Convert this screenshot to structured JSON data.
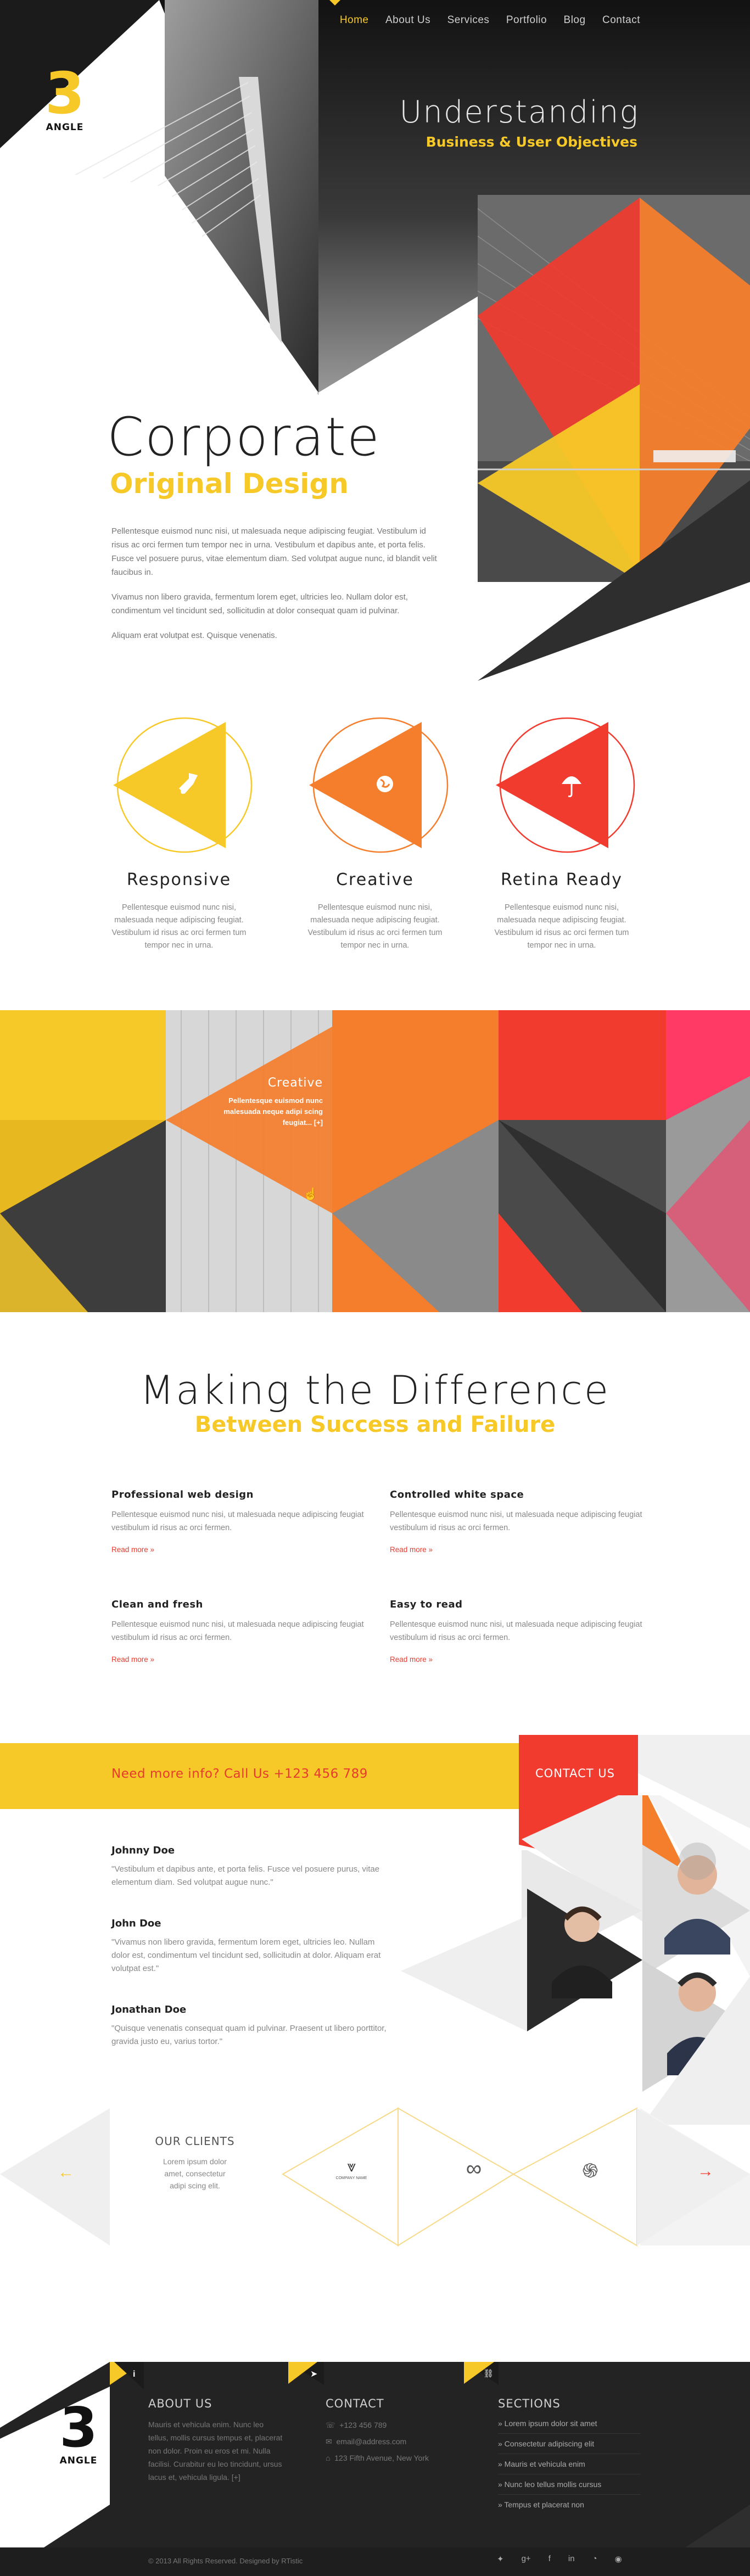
{
  "brand": {
    "logo_number": "3",
    "logo_word": "ANGLE",
    "accent_yellow": "#f7c928",
    "accent_orange": "#f57e2c",
    "accent_red": "#f23b2f",
    "accent_pink": "#ff3a64"
  },
  "nav": {
    "items": [
      {
        "label": "Home",
        "active": true
      },
      {
        "label": "About Us",
        "active": false
      },
      {
        "label": "Services",
        "active": false
      },
      {
        "label": "Portfolio",
        "active": false
      },
      {
        "label": "Blog",
        "active": false
      },
      {
        "label": "Contact",
        "active": false
      }
    ]
  },
  "hero": {
    "top_title": "Understanding",
    "top_subtitle": "Business & User Objectives",
    "title": "Corporate",
    "subtitle": "Original Design",
    "paragraphs": [
      "Pellentesque euismod nunc nisi, ut malesuada neque adipiscing feugiat. Vestibulum id risus ac orci fermen tum tempor nec in urna. Vestibulum et dapibus ante, et porta felis. Fusce vel posuere purus, vitae elementum diam. Sed volutpat augue nunc, id blandit velit faucibus in.",
      "Vivamus non libero gravida, fermentum lorem eget, ultricies leo. Nullam dolor est, condimentum vel tincidunt sed, sollicitudin at dolor consequat quam id pulvinar.",
      "Aliquam erat volutpat est. Quisque venenatis."
    ]
  },
  "features": [
    {
      "icon": "rocket-icon",
      "title": "Responsive",
      "text": "Pellentesque euismod nunc nisi, malesuada neque adipiscing feugiat. Vestibulum id risus ac orci fermen tum tempor nec in urna.",
      "color": "#f7c928"
    },
    {
      "icon": "globe-icon",
      "title": "Creative",
      "text": "Pellentesque euismod nunc nisi, malesuada neque adipiscing feugiat. Vestibulum id risus ac orci fermen tum tempor nec in urna.",
      "color": "#f57e2c"
    },
    {
      "icon": "umbrella-icon",
      "title": "Retina Ready",
      "text": "Pellentesque euismod nunc nisi, malesuada neque adipiscing feugiat. Vestibulum id risus ac orci fermen tum tempor nec in urna.",
      "color": "#f23b2f"
    }
  ],
  "portfolio": {
    "hover_title": "Creative",
    "hover_text": "Pellentesque euismod nunc malesuada neque adipi scing feugiat... [+]"
  },
  "difference": {
    "title": "Making the Difference",
    "subtitle": "Between Success and Failure",
    "items": [
      {
        "title": "Professional web design",
        "text": "Pellentesque euismod nunc nisi, ut malesuada neque adipiscing feugiat vestibulum id risus ac orci fermen.",
        "link": "Read more »"
      },
      {
        "title": "Controlled white space",
        "text": "Pellentesque euismod nunc nisi, ut malesuada neque adipiscing feugiat vestibulum id risus ac orci fermen.",
        "link": "Read more »"
      },
      {
        "title": "Clean and fresh",
        "text": "Pellentesque euismod nunc nisi, ut malesuada neque adipiscing feugiat vestibulum id risus ac orci fermen.",
        "link": "Read more »"
      },
      {
        "title": "Easy to read",
        "text": "Pellentesque euismod nunc nisi, ut malesuada neque adipiscing feugiat vestibulum id risus ac orci fermen.",
        "link": "Read more »"
      }
    ]
  },
  "cta": {
    "text": "Need more info? Call Us +123 456 789",
    "button": "CONTACT US"
  },
  "testimonials": [
    {
      "name": "Johnny Doe",
      "quote": "\"Vestibulum et dapibus ante, et porta felis. Fusce vel posuere purus, vitae elementum diam. Sed volutpat augue nunc.\""
    },
    {
      "name": "John Doe",
      "quote": "\"Vivamus non libero gravida, fermentum lorem eget, ultricies leo. Nullam dolor est, condimentum vel tincidunt sed, sollicitudin at dolor. Aliquam erat volutpat est.\""
    },
    {
      "name": "Jonathan Doe",
      "quote": "\"Quisque venenatis consequat quam id pulvinar. Praesent ut libero porttitor, gravida justo eu, varius tortor.\""
    }
  ],
  "clients": {
    "title": "OUR CLIENTS",
    "text": "Lorem ipsum dolor amet, consectetur adipi scing elit.",
    "logos": [
      {
        "name": "wings-logo",
        "caption": "COMPANY NAME"
      },
      {
        "name": "infinity-logo",
        "caption": ""
      },
      {
        "name": "swirl-logo",
        "caption": ""
      }
    ]
  },
  "footer": {
    "about": {
      "heading": "ABOUT US",
      "text": "Mauris et vehicula enim. Nunc leo tellus, mollis cursus tempus et, placerat non dolor. Proin eu eros et mi. Nulla facilisi. Curabitur eu leo tincidunt, ursus lacus et, vehicula ligula. [+]"
    },
    "contact": {
      "heading": "CONTACT",
      "phone": "+123 456 789",
      "email": "email@address.com",
      "address": "123 Fifth Avenue, New York"
    },
    "sections": {
      "heading": "SECTIONS",
      "items": [
        "» Lorem ipsum dolor sit amet",
        "» Consectetur adipiscing elit",
        "» Mauris et vehicula enim",
        "» Nunc leo tellus mollis cursus",
        "» Tempus et placerat non"
      ]
    },
    "copyright": "© 2013 All Rights Reserved. Designed by RTistic",
    "social": [
      "twitter-icon",
      "googleplus-icon",
      "facebook-icon",
      "linkedin-icon",
      "rss-icon",
      "dribbble-icon"
    ]
  }
}
